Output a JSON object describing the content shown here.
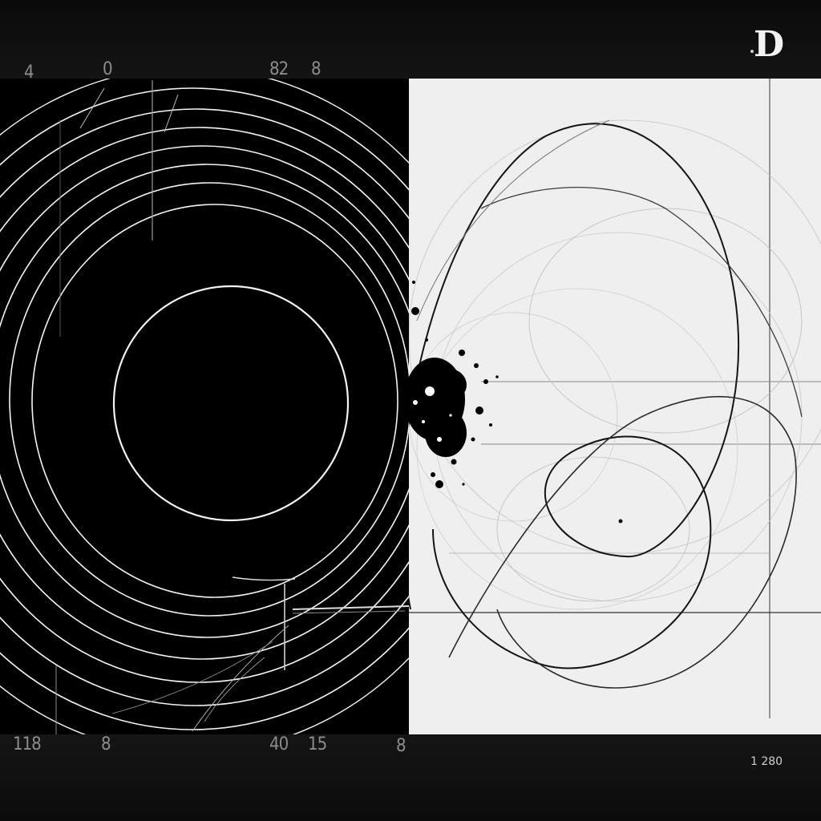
{
  "logo_text": "D",
  "top_labels": [
    "4",
    "0",
    "82",
    "8"
  ],
  "bottom_labels": [
    "118",
    "8",
    "40",
    "15",
    "8"
  ],
  "corner_number": "1 280",
  "colors": {
    "dark": "#000000",
    "light": "#efefef",
    "line_dark": "#ffffff",
    "line_light": "#1a1a1a"
  }
}
